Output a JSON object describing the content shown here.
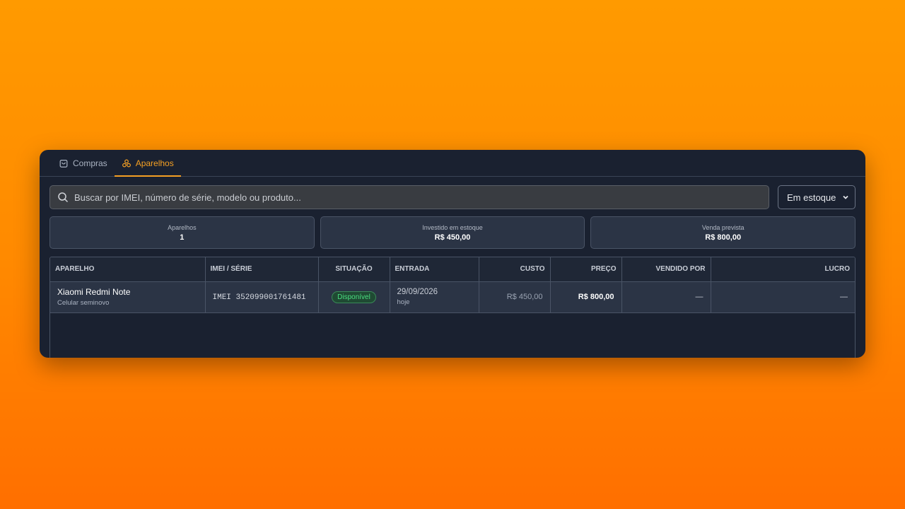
{
  "tabs": [
    {
      "label": "Compras",
      "icon": "shopping-bag-icon",
      "active": false
    },
    {
      "label": "Aparelhos",
      "icon": "devices-icon",
      "active": true
    }
  ],
  "search": {
    "placeholder": "Buscar por IMEI, número de série, modelo ou produto...",
    "value": ""
  },
  "filter": {
    "selected": "Em estoque"
  },
  "stats": [
    {
      "label": "Aparelhos",
      "value": "1"
    },
    {
      "label": "Investido em estoque",
      "value": "R$ 450,00"
    },
    {
      "label": "Venda prevista",
      "value": "R$ 800,00"
    }
  ],
  "table": {
    "headers": [
      "APARELHO",
      "IMEI / SÉRIE",
      "SITUAÇÃO",
      "ENTRADA",
      "CUSTO",
      "PREÇO",
      "VENDIDO POR",
      "LUCRO"
    ],
    "rows": [
      {
        "name": "Xiaomi Redmi Note",
        "subtitle": "Celular seminovo",
        "imei": "IMEI 352099001761481",
        "status": "Disponível",
        "date": "29/09/2026",
        "date_rel": "hoje",
        "cost": "R$ 450,00",
        "price": "R$ 800,00",
        "sold_by": "—",
        "profit": "—"
      }
    ]
  },
  "colors": {
    "accent": "#f5a023",
    "status_available": "#4ade80",
    "panel": "#1a2130"
  }
}
